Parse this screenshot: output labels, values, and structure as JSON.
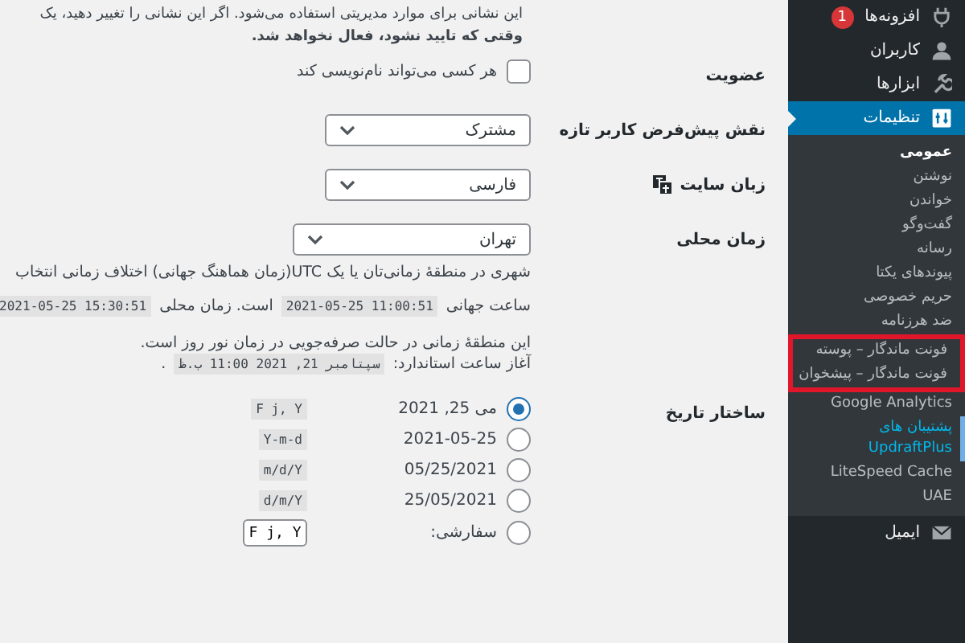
{
  "notice": {
    "line_1": "این نشانی برای موارد مدیریتی استفاده می‌شود. اگر این نشانی را تغییر دهید، یک",
    "line_2": "وقتی که تایید نشود، فعال نخواهد شد."
  },
  "settings": [
    {
      "kind": "checkbox",
      "label": "عضویت",
      "option": "هر کسی می‌تواند نام‌نویسی کند",
      "checked": false
    },
    {
      "kind": "select",
      "label": "نقش پیش‌فرض کاربر تازه",
      "value": "مشترک"
    },
    {
      "kind": "language_select",
      "label": "زبان سایت",
      "value": "فارسی"
    },
    {
      "kind": "timezone",
      "label": "زمان محلی",
      "value": "تهران",
      "description": "شهری در منطقهٔ زمانی‌تان یا یک UTC(زمان هماهنگ جهانی) اختلاف زمانی انتخاب",
      "utc_prefix": "ساعت جهانی",
      "utc_time": "2021-05-25 11:00:51",
      "local_prefix": "است. زمان محلی",
      "local_time": "2021-05-25 15:30:51",
      "dst_note": "این منطقهٔ زمانی در حالت صرفه‌جویی در زمان نور روز است.",
      "dst_start_prefix": "آغاز ساعت استاندارد:",
      "dst_start": "سپتامبر 21, 2021 11:00 ب.ظ",
      "dst_start_suffix": "."
    },
    {
      "kind": "radios",
      "label": "ساختار تاریخ",
      "options": [
        {
          "kind": "preset",
          "text": "می 25, 2021",
          "code": "F j, Y",
          "selected": true
        },
        {
          "kind": "preset",
          "text": "2021-05-25",
          "code": "Y-m-d",
          "selected": false
        },
        {
          "kind": "preset",
          "text": "05/25/2021",
          "code": "m/d/Y",
          "selected": false
        },
        {
          "kind": "preset",
          "text": "25/05/2021",
          "code": "d/m/Y",
          "selected": false
        },
        {
          "kind": "custom",
          "text": "سفارشی:",
          "value": "F j, Y",
          "selected": false
        }
      ]
    }
  ],
  "sidebar": {
    "items": [
      {
        "label": "افزونه‌ها",
        "badge": "1",
        "selected": false
      },
      {
        "label": "کاربران",
        "selected": false
      },
      {
        "label": "ابزارها",
        "selected": false
      },
      {
        "label": "تنظیمات",
        "selected": true,
        "children": [
          {
            "label": "عمومی",
            "selected": true,
            "outlined": false,
            "hovered": false
          },
          {
            "label": "نوشتن",
            "selected": false,
            "outlined": false,
            "hovered": false
          },
          {
            "label": "خواندن",
            "selected": false,
            "outlined": false,
            "hovered": false
          },
          {
            "label": "گفت‌وگو",
            "selected": false,
            "outlined": false,
            "hovered": false
          },
          {
            "label": "رسانه",
            "selected": false,
            "outlined": false,
            "hovered": false
          },
          {
            "label": "پیوندهای یکتا",
            "selected": false,
            "outlined": false,
            "hovered": false
          },
          {
            "label": "حریم خصوصی",
            "selected": false,
            "outlined": false,
            "hovered": false
          },
          {
            "label": "ضد هرزنامه",
            "selected": false,
            "outlined": false,
            "hovered": false
          },
          {
            "label": "فونت ماندگار – پوسته",
            "selected": false,
            "outlined": true,
            "hovered": false
          },
          {
            "label": "فونت ماندگار – پیشخوان",
            "selected": false,
            "outlined": true,
            "hovered": false
          },
          {
            "label": "Google Analytics",
            "selected": false,
            "outlined": false,
            "hovered": false
          },
          {
            "label": "پشتیبان های UpdraftPlus",
            "selected": false,
            "outlined": false,
            "hovered": true
          },
          {
            "label": "LiteSpeed Cache",
            "selected": false,
            "outlined": false,
            "hovered": false
          },
          {
            "label": "UAE",
            "selected": false,
            "outlined": false,
            "hovered": false
          }
        ]
      },
      {
        "label": "ایمیل",
        "selected": false
      }
    ]
  }
}
